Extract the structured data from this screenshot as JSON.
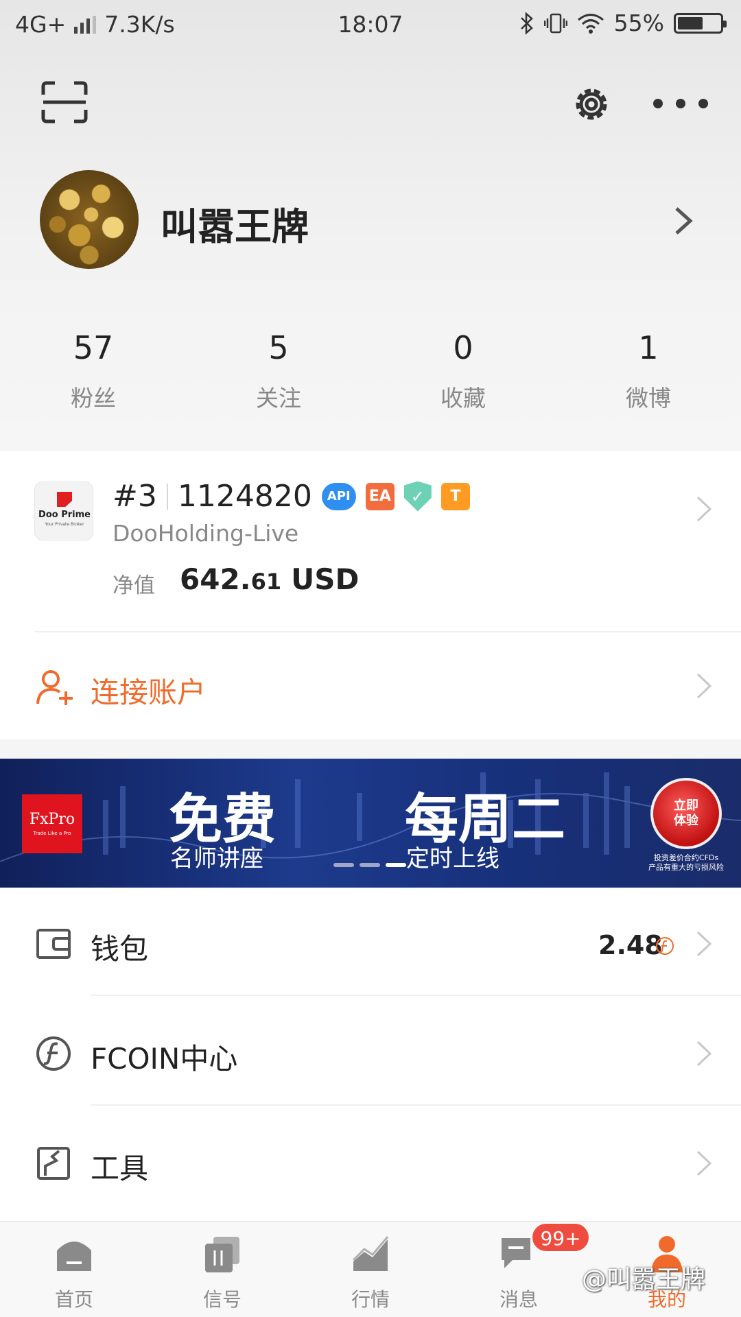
{
  "status_bar": {
    "network": "4G+",
    "speed": "7.3K/s",
    "time": "18:07",
    "battery": "55%"
  },
  "profile": {
    "username": "叫嚣王牌",
    "stats": [
      {
        "value": "57",
        "label": "粉丝"
      },
      {
        "value": "5",
        "label": "关注"
      },
      {
        "value": "0",
        "label": "收藏"
      },
      {
        "value": "1",
        "label": "微博"
      }
    ]
  },
  "account": {
    "broker_name": "Doo Prime",
    "broker_tagline": "Your Private Broker",
    "rank": "#3",
    "number": "1124820",
    "badges": {
      "api": "API",
      "ea": "EA",
      "t": "T"
    },
    "server": "DooHolding-Live",
    "equity_label": "净值",
    "equity_int": "642.",
    "equity_dec": "61",
    "equity_currency": "USD",
    "connect_label": "连接账户"
  },
  "banner": {
    "logo_text": "FxPro",
    "logo_tagline": "Trade Like a Pro",
    "headline_1": "免费",
    "sub_1": "名师讲座",
    "headline_2": "每周二",
    "sub_2": "定时上线",
    "button": "立即体验",
    "risk_1": "投资差价合约CFDs",
    "risk_2": "产品有重大的亏损风险",
    "slides": 3,
    "active_slide": 3
  },
  "menu": {
    "wallet_label": "钱包",
    "wallet_value": "2.48",
    "fcoin_label": "FCOIN中心",
    "tools_label": "工具"
  },
  "tabbar": {
    "tabs": [
      "首页",
      "信号",
      "行情",
      "消息",
      "我的"
    ],
    "active": "我的",
    "message_badge": "99+"
  },
  "watermark": "@叫嚣王牌",
  "colors": {
    "accent": "#f06b2b",
    "badge_red": "#ef4b3f",
    "banner_bg": "#1d3a8c"
  }
}
